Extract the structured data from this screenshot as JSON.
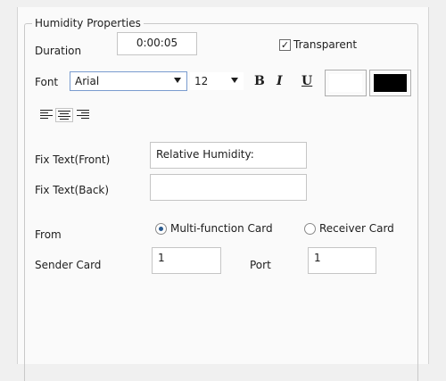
{
  "group_title": "Humidity Properties",
  "duration": {
    "label": "Duration",
    "value": "0:00:05"
  },
  "transparent": {
    "label": "Transparent",
    "checked": true
  },
  "font": {
    "label": "Font",
    "family": "Arial",
    "size": "12",
    "bold_label": "B",
    "italic_label": "I",
    "underline_label": "U",
    "fore_color": "#ffffff",
    "back_color": "#000000"
  },
  "alignment": [
    "align-left",
    "align-center",
    "align-right"
  ],
  "fix_text_front": {
    "label": "Fix Text(Front)",
    "value": "Relative Humidity:"
  },
  "fix_text_back": {
    "label": "Fix Text(Back)",
    "value": ""
  },
  "from": {
    "label": "From",
    "options": [
      {
        "label": "Multi-function Card",
        "selected": true
      },
      {
        "label": "Receiver Card",
        "selected": false
      }
    ]
  },
  "sender_card": {
    "label": "Sender Card",
    "value": "1"
  },
  "port": {
    "label": "Port",
    "value": "1"
  }
}
